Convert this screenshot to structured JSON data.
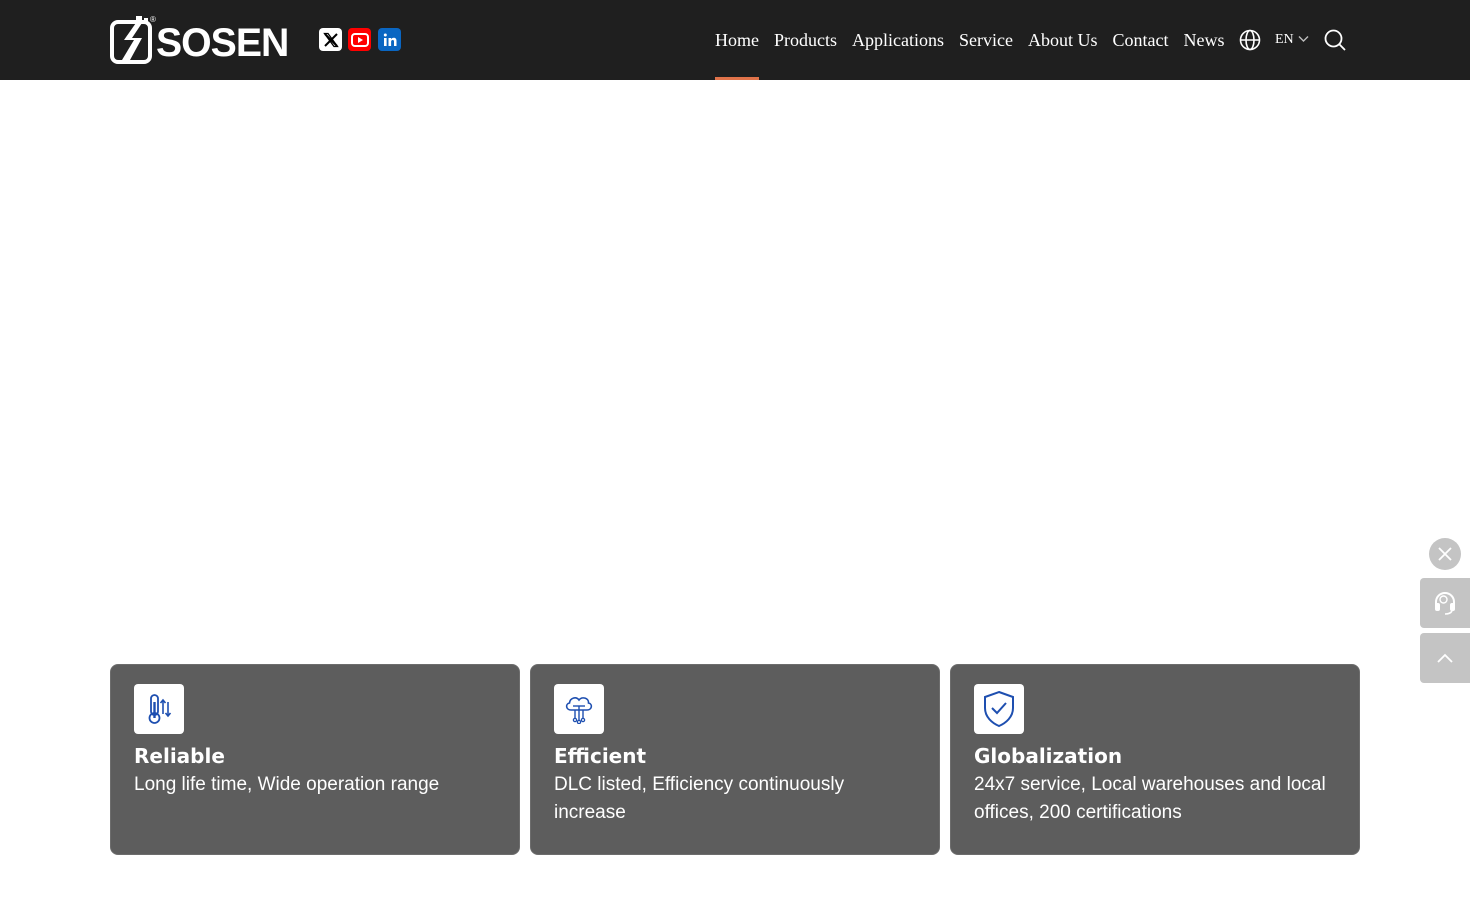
{
  "header": {
    "logo_text": "SOSEN",
    "logo_mark": "®",
    "social": [
      {
        "icon": "x-twitter-icon"
      },
      {
        "icon": "youtube-icon"
      },
      {
        "icon": "linkedin-icon"
      }
    ],
    "nav": [
      {
        "label": "Home",
        "active": true
      },
      {
        "label": "Products"
      },
      {
        "label": "Applications"
      },
      {
        "label": "Service"
      },
      {
        "label": "About Us"
      },
      {
        "label": "Contact"
      },
      {
        "label": "News"
      }
    ],
    "language": "EN",
    "accent_color": "#e0734a"
  },
  "features": [
    {
      "icon": "thermometer-icon",
      "title": "Reliable",
      "description": "Long life time, Wide operation range"
    },
    {
      "icon": "cloud-chip-icon",
      "title": "Efficient",
      "description": "DLC listed, Efficiency continuously increase"
    },
    {
      "icon": "shield-check-icon",
      "title": "Globalization",
      "description": "24x7 service, Local warehouses and local offices, 200 certifications"
    }
  ],
  "colors": {
    "header_bg": "#1f1f1f",
    "card_bg": "#5d5d5d",
    "icon_blue": "#1e4fb0"
  }
}
